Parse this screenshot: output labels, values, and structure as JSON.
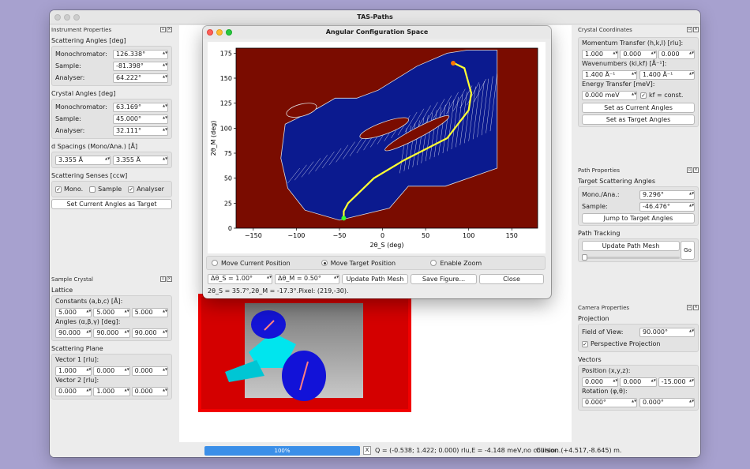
{
  "window": {
    "title": "TAS-Paths"
  },
  "instrument": {
    "dock_title": "Instrument Properties",
    "scattering_angles": {
      "title": "Scattering Angles [deg]",
      "mono_label": "Monochromator:",
      "mono": "126.338°",
      "sample_label": "Sample:",
      "sample": "-81.398°",
      "ana_label": "Analyser:",
      "ana": "64.222°"
    },
    "crystal_angles": {
      "title": "Crystal Angles [deg]",
      "mono_label": "Monochromator:",
      "mono": "63.169°",
      "sample_label": "Sample:",
      "sample": "45.000°",
      "ana_label": "Analyser:",
      "ana": "32.111°"
    },
    "d_spacings": {
      "title": "d Spacings (Mono/Ana.) [Å]",
      "mono": "3.355 Å",
      "ana": "3.355 Å"
    },
    "senses": {
      "title": "Scattering Senses [ccw]",
      "mono": "Mono.",
      "sample": "Sample",
      "ana": "Analyser",
      "mono_checked": "✓",
      "ana_checked": "✓"
    },
    "set_target_button": "Set Current Angles as Target"
  },
  "sample_crystal": {
    "dock_title": "Sample Crystal",
    "lattice_title": "Lattice",
    "constants_label": "Constants (a,b,c) [Å]:",
    "constants": [
      "5.000",
      "5.000",
      "5.000"
    ],
    "angles_label": "Angles (α,β,γ) [deg]:",
    "angles": [
      "90.000",
      "90.000",
      "90.000"
    ],
    "plane_title": "Scattering Plane",
    "vec1_label": "Vector 1 [rlu]:",
    "vec1": [
      "1.000",
      "0.000",
      "0.000"
    ],
    "vec2_label": "Vector 2 [rlu]:",
    "vec2": [
      "0.000",
      "1.000",
      "0.000"
    ]
  },
  "crystal_coords": {
    "dock_title": "Crystal Coordinates",
    "momentum_label": "Momentum Transfer (h,k,l) [rlu]:",
    "momentum": [
      "1.000",
      "0.000",
      "0.000"
    ],
    "wavenumbers_label": "Wavenumbers (ki,kf) [Å⁻¹]:",
    "ki": "1.400 Å⁻¹",
    "kf": "1.400 Å⁻¹",
    "energy_label": "Energy Transfer [meV]:",
    "energy": "0.000 meV",
    "kf_const": "kf = const.",
    "kf_const_checked": "✓",
    "set_current_button": "Set as Current Angles",
    "set_target_button": "Set as Target Angles"
  },
  "path_props": {
    "dock_title": "Path Properties",
    "target_title": "Target Scattering Angles",
    "mono_label": "Mono./Ana.:",
    "mono": "9.296°",
    "sample_label": "Sample:",
    "sample": "-46.476°",
    "jump_button": "Jump to Target Angles",
    "tracking_title": "Path Tracking",
    "update_button": "Update Path Mesh",
    "go_button": "Go"
  },
  "camera": {
    "dock_title": "Camera Properties",
    "projection_title": "Projection",
    "fov_label": "Field of View:",
    "fov": "90.000°",
    "perspective": "Perspective Projection",
    "perspective_checked": "✓",
    "vectors_title": "Vectors",
    "position_label": "Position (x,y,z):",
    "position": [
      "0.000",
      "0.000",
      "-15.000"
    ],
    "rotation_label": "Rotation (φ,θ):",
    "rotation": [
      "0.000°",
      "0.000°"
    ]
  },
  "status": {
    "progress_label": "100%",
    "progress": 1.0,
    "x_button": "X",
    "info": "Q = (-0.538; 1.422; 0.000) rlu,E = -4.148 meV,no collision.",
    "cursor": "Cursor: (+4.517,-8.645) m."
  },
  "dialog": {
    "title": "Angular Configuration Space",
    "ylabel": "2θ_M (deg)",
    "xlabel": "2θ_S (deg)",
    "xticks": [
      "−150",
      "−100",
      "−50",
      "0",
      "50",
      "100",
      "150"
    ],
    "yticks": [
      "0",
      "25",
      "50",
      "75",
      "100",
      "125",
      "150",
      "175"
    ],
    "radio_current": "Move Current Position",
    "radio_target": "Move Target Position",
    "radio_zoom": "Enable Zoom",
    "d2ths": "Δθ_S = 1.00°",
    "d2thm": "Δθ_M = 0.50°",
    "update_button": "Update Path Mesh",
    "save_button": "Save Figure...",
    "close_button": "Close",
    "readout": "2θ_S = 35.7°,2θ_M = -17.3°.Pixel: (219,-30)."
  },
  "chart_data": {
    "type": "heatmap",
    "xlabel": "2θ_S (deg)",
    "ylabel": "2θ_M (deg)",
    "xlim": [
      -170,
      180
    ],
    "ylim": [
      0,
      180
    ],
    "xticks": [
      -150,
      -100,
      -50,
      0,
      50,
      100,
      150
    ],
    "yticks": [
      0,
      25,
      50,
      75,
      100,
      125,
      150,
      175
    ],
    "colors": {
      "forbidden": "#7a0c00",
      "allowed": "#0b1a8f",
      "mesh": "#ffffff",
      "path": "#ffff33",
      "start": "#37ff2c",
      "end": "#ff7700"
    },
    "region_outer": [
      [
        -113,
        104
      ],
      [
        -75,
        120
      ],
      [
        -55,
        130
      ],
      [
        -30,
        130
      ],
      [
        -5,
        138
      ],
      [
        40,
        162
      ],
      [
        75,
        175
      ],
      [
        98,
        178
      ],
      [
        133,
        178
      ],
      [
        133,
        60
      ],
      [
        73,
        42
      ],
      [
        30,
        42
      ],
      [
        8,
        20
      ],
      [
        -50,
        8
      ],
      [
        -90,
        18
      ],
      [
        -110,
        40
      ],
      [
        -118,
        70
      ]
    ],
    "holes": [
      {
        "cx": 2,
        "cy": 100,
        "rx": 30,
        "ry": 6,
        "rotation": -20
      },
      {
        "cx": 40,
        "cy": 95,
        "rx": 42,
        "ry": 5,
        "rotation": -28
      },
      {
        "cx": -94,
        "cy": 118,
        "rx": 18,
        "ry": 6,
        "rotation": -15
      }
    ],
    "path": [
      [
        -45,
        10
      ],
      [
        -45,
        17
      ],
      [
        -40,
        25
      ],
      [
        -10,
        50
      ],
      [
        25,
        68
      ],
      [
        75,
        90
      ],
      [
        100,
        118
      ],
      [
        103,
        135
      ],
      [
        95,
        160
      ],
      [
        83,
        165
      ]
    ],
    "start": [
      -45,
      10
    ],
    "end": [
      82,
      165
    ]
  }
}
